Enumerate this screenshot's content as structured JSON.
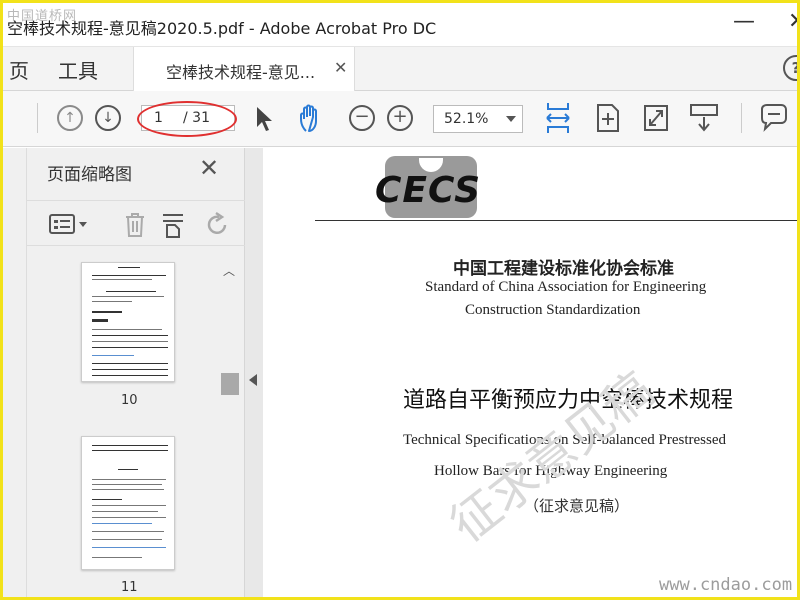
{
  "window": {
    "title": "空棒技术规程-意见稿2020.5.pdf - Adobe Acrobat Pro DC",
    "minimize_glyph": "—",
    "close_glyph": "✕"
  },
  "menu": {
    "home": "页",
    "tools": "工具"
  },
  "tab": {
    "label": "空棒技术规程-意见...",
    "close_glyph": "✕"
  },
  "toolbar": {
    "page_current": "1",
    "page_total": "/ 31",
    "zoom": "52.1%"
  },
  "sidebar": {
    "title": "页面缩略图",
    "close_glyph": "✕",
    "thumbnails": [
      {
        "label": "10"
      },
      {
        "label": "11"
      }
    ]
  },
  "document": {
    "logo_text": "CECS",
    "org_cn": "中国工程建设标准化协会标准",
    "org_en_1": "Standard of China Association for Engineering",
    "org_en_2": "Construction Standardization",
    "title_cn": "道路自平衡预应力中空棒技术规程",
    "title_en_1": "Technical Specifications on Self-balanced Prestressed",
    "title_en_2": "Hollow Bars for Highway Engineering",
    "draft_label": "（征求意见稿）"
  },
  "watermarks": {
    "stamp": "征求意见稿",
    "site_top": "中国道桥网",
    "site_bottom": "www.cndao.com"
  },
  "colors": {
    "accent_blue": "#2a7bd6",
    "annotation_red": "#e03030",
    "frame_yellow": "#f2e21a"
  },
  "icons": [
    "help-icon",
    "arrow-up-circle-icon",
    "arrow-down-circle-icon",
    "pointer-icon",
    "hand-icon",
    "zoom-out-icon",
    "zoom-in-icon",
    "fit-width-icon",
    "fit-page-icon",
    "fullscreen-icon",
    "scroll-mode-icon",
    "comment-icon",
    "options-menu-icon",
    "trash-icon",
    "insert-page-icon",
    "rotate-icon"
  ]
}
